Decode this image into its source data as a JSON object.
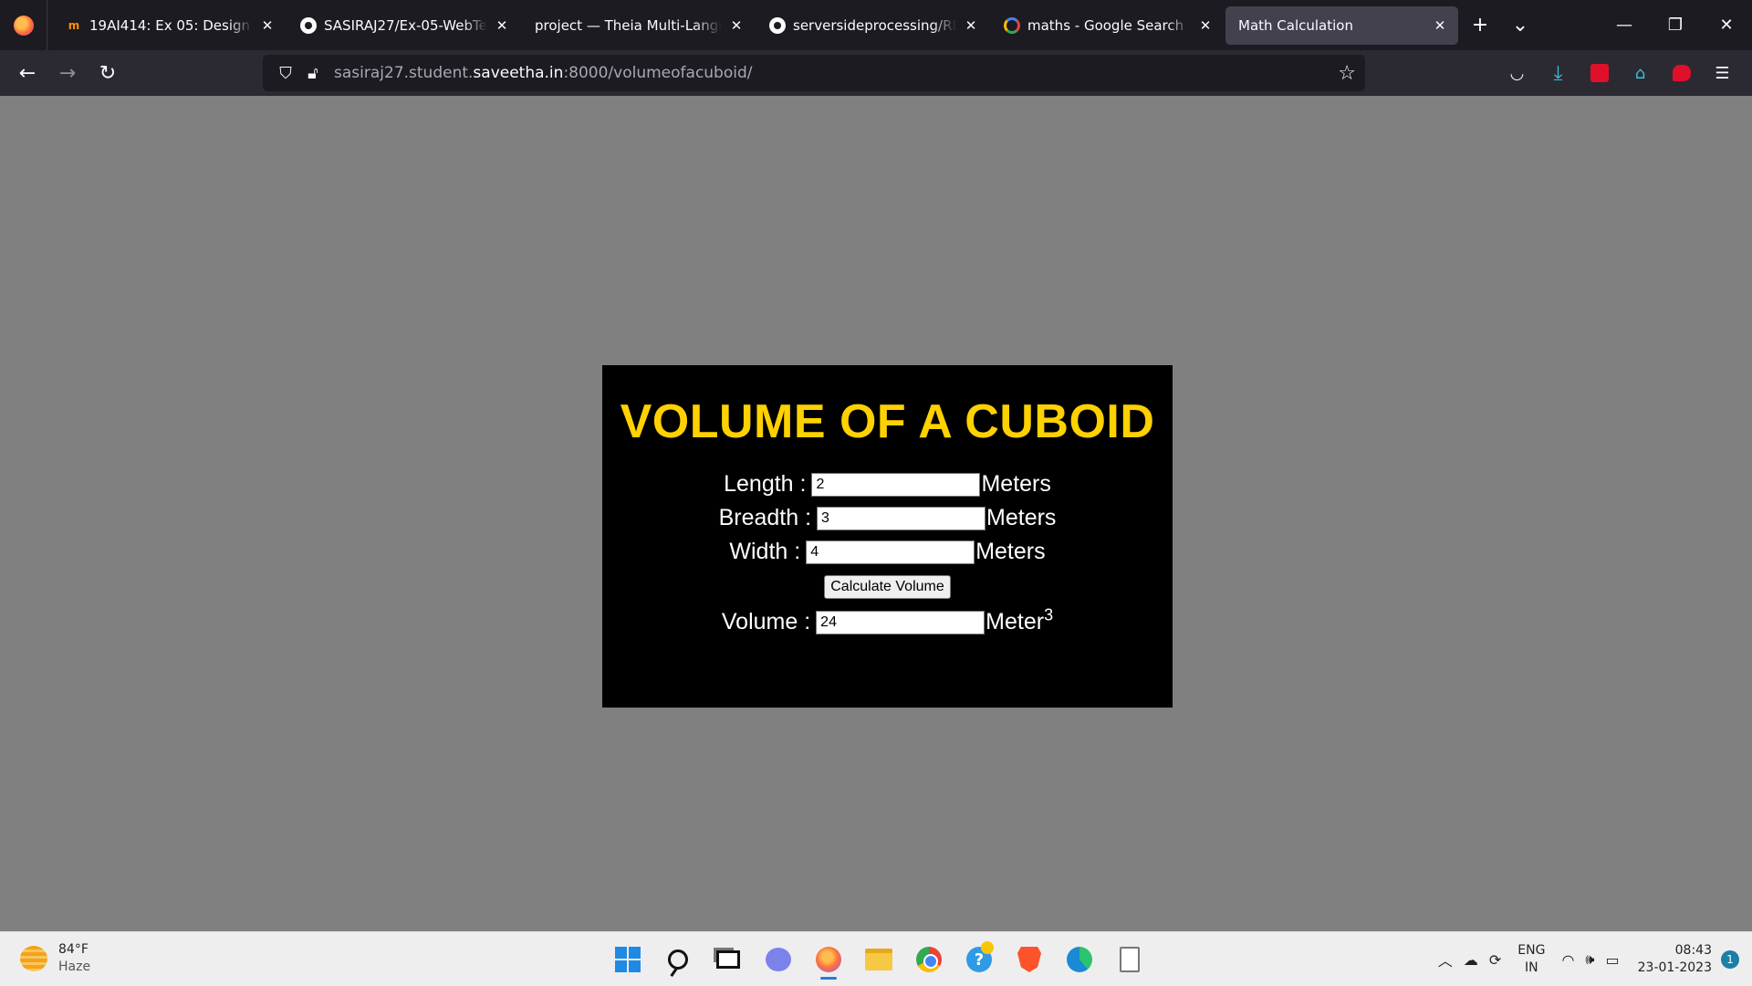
{
  "browser": {
    "tabs": [
      {
        "title": "19AI414: Ex 05: Design a We",
        "icon": "moodle-icon",
        "active": false
      },
      {
        "title": "SASIRAJ27/Ex-05-WebTech-",
        "icon": "github-icon",
        "active": false
      },
      {
        "title": "project — Theia Multi-Language",
        "icon": "",
        "active": false
      },
      {
        "title": "serversideprocessing/READ",
        "icon": "github-icon",
        "active": false
      },
      {
        "title": "maths - Google Search",
        "icon": "google-icon",
        "active": false
      },
      {
        "title": "Math Calculation",
        "icon": "",
        "active": true
      }
    ],
    "url": {
      "prefix": "sasiraj27.student.",
      "host": "saveetha.in",
      "suffix": ":8000/volumeofacuboid/"
    }
  },
  "page": {
    "title": "VOLUME OF A CUBOID",
    "length": {
      "label": "Length :",
      "value": "2",
      "unit": "Meters"
    },
    "breadth": {
      "label": "Breadth :",
      "value": "3",
      "unit": "Meters"
    },
    "width": {
      "label": "Width :",
      "value": "4",
      "unit": "Meters"
    },
    "button_label": "Calculate Volume",
    "volume": {
      "label": "Volume :",
      "value": "24",
      "unit": "Meter",
      "unit_sup": "3"
    }
  },
  "taskbar": {
    "weather_temp": "84°F",
    "weather_cond": "Haze",
    "lang_line1": "ENG",
    "lang_line2": "IN",
    "time": "08:43",
    "date": "23-01-2023",
    "notification_count": "1"
  },
  "colors": {
    "title": "#ffd100",
    "card_bg": "#000000",
    "page_bg": "#808080"
  }
}
